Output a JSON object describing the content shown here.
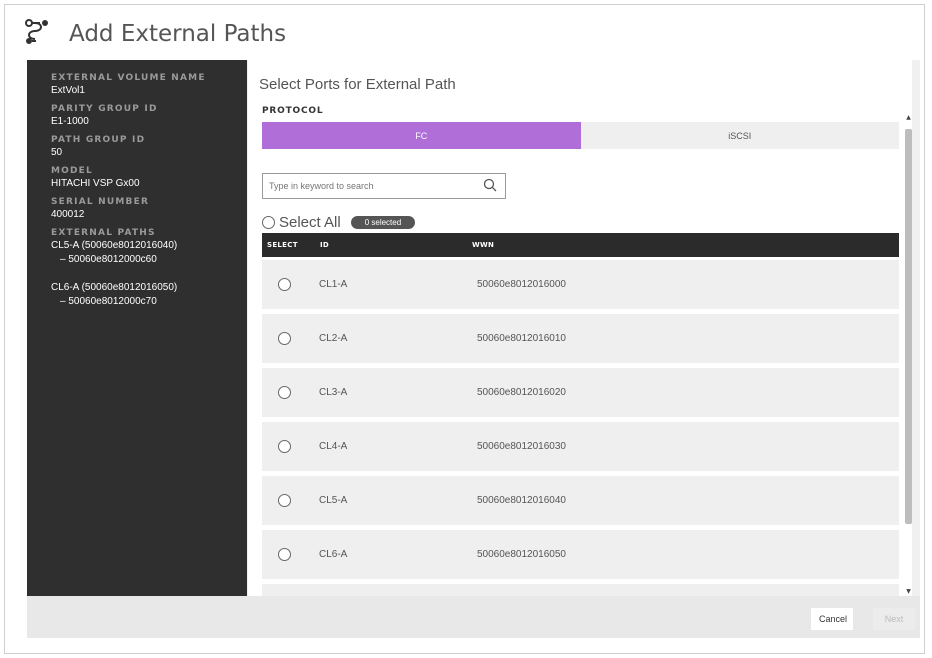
{
  "dialog": {
    "title": "Add External Paths",
    "icon": "path-connection-icon"
  },
  "sidebar": {
    "fields": [
      {
        "label": "EXTERNAL VOLUME NAME",
        "value": "ExtVol1"
      },
      {
        "label": "PARITY GROUP ID",
        "value": "E1-1000"
      },
      {
        "label": "PATH GROUP ID",
        "value": "50"
      },
      {
        "label": "MODEL",
        "value": "HITACHI VSP Gx00"
      },
      {
        "label": "SERIAL NUMBER",
        "value": "400012"
      }
    ],
    "paths_label": "EXTERNAL PATHS",
    "paths": [
      {
        "port": "CL5-A (50060e8012016040)",
        "target": "– 50060e8012000c60"
      },
      {
        "port": "CL6-A (50060e8012016050)",
        "target": "– 50060e8012000c70"
      }
    ]
  },
  "main": {
    "title": "Select Ports for External Path",
    "protocol_label": "PROTOCOL",
    "protocols": [
      {
        "label": "FC",
        "active": true
      },
      {
        "label": "iSCSI",
        "active": false
      }
    ],
    "search": {
      "placeholder": "Type in keyword to search",
      "value": "",
      "icon": "search-icon"
    },
    "select_all_label": "Select All",
    "selected_badge": "0 selected",
    "table": {
      "headers": {
        "select": "SELECT",
        "id": "ID",
        "wwn": "WWN"
      },
      "rows": [
        {
          "id": "CL1-A",
          "wwn": "50060e8012016000"
        },
        {
          "id": "CL2-A",
          "wwn": "50060e8012016010"
        },
        {
          "id": "CL3-A",
          "wwn": "50060e8012016020"
        },
        {
          "id": "CL4-A",
          "wwn": "50060e8012016030"
        },
        {
          "id": "CL5-A",
          "wwn": "50060e8012016040"
        },
        {
          "id": "CL6-A",
          "wwn": "50060e8012016050"
        }
      ]
    }
  },
  "footer": {
    "cancel_label": "Cancel",
    "next_label": "Next"
  },
  "colors": {
    "accent": "#b06ed8",
    "sidebar_bg": "#2f2f2f",
    "header_bg": "#2b2b2b"
  }
}
